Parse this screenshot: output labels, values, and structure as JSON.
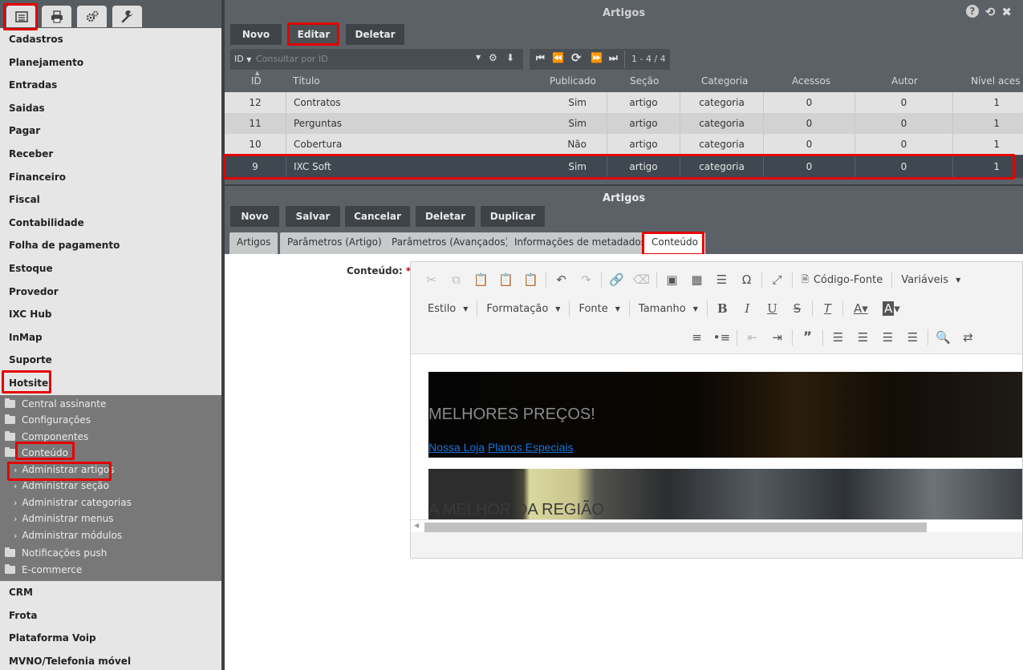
{
  "sidebar": {
    "top_buttons": [
      {
        "name": "menu-icon"
      },
      {
        "name": "print-icon"
      },
      {
        "name": "cogs-icon"
      },
      {
        "name": "wrench-icon"
      }
    ],
    "menu_top": [
      "Cadastros",
      "Planejamento",
      "Entradas",
      "Saidas",
      "Pagar",
      "Receber",
      "Financeiro",
      "Fiscal",
      "Contabilidade",
      "Folha de pagamento",
      "Estoque",
      "Provedor",
      "IXC Hub",
      "InMap",
      "Suporte",
      "Hotsite"
    ],
    "hotsite_children": {
      "folders_before": [
        "Central assinante",
        "Configurações",
        "Componentes"
      ],
      "open_folder": "Conteúdo",
      "leaves": [
        "Administrar artigos",
        "Administrar seção",
        "Administrar categorias",
        "Administrar menus",
        "Administrar módulos"
      ],
      "folders_after": [
        "Notificações push",
        "E-commerce"
      ]
    },
    "menu_bottom": [
      "CRM",
      "Frota",
      "Plataforma Voip",
      "MVNO/Telefonia móvel"
    ]
  },
  "list_panel": {
    "title": "Artigos",
    "buttons": {
      "new": "Novo",
      "edit": "Editar",
      "delete": "Deletar"
    },
    "search": {
      "field": "ID",
      "placeholder": "Consultar por ID"
    },
    "pagination": "1 - 4 / 4",
    "columns": [
      "ID",
      "Título",
      "Publicado",
      "Seção",
      "Categoria",
      "Acessos",
      "Autor",
      "Nível aces"
    ],
    "rows": [
      {
        "id": "12",
        "title": "Contratos",
        "published": "Sim",
        "section": "artigo",
        "category": "categoria",
        "views": "0",
        "author": "0",
        "level": "1"
      },
      {
        "id": "11",
        "title": "Perguntas",
        "published": "Sim",
        "section": "artigo",
        "category": "categoria",
        "views": "0",
        "author": "0",
        "level": "1"
      },
      {
        "id": "10",
        "title": "Cobertura",
        "published": "Não",
        "section": "artigo",
        "category": "categoria",
        "views": "0",
        "author": "0",
        "level": "1"
      },
      {
        "id": "9",
        "title": "IXC Soft",
        "published": "Sim",
        "section": "artigo",
        "category": "categoria",
        "views": "0",
        "author": "0",
        "level": "1"
      }
    ]
  },
  "form_panel": {
    "title": "Artigos",
    "buttons": {
      "new": "Novo",
      "save": "Salvar",
      "cancel": "Cancelar",
      "delete": "Deletar",
      "duplicate": "Duplicar"
    },
    "tabs": [
      "Artigos",
      "Parâmetros (Artigo)",
      "Parâmetros (Avançados)",
      "Informações de metadados",
      "Conteúdo"
    ],
    "field_label": "Conteúdo:",
    "required_mark": "*",
    "editor": {
      "source_label": "Código-Fonte",
      "variables_label": "Variáveis",
      "style_label": "Estilo",
      "format_label": "Formatação",
      "font_label": "Fonte",
      "size_label": "Tamanho",
      "banner1_heading": "MELHORES PREÇOS!",
      "link1": "Nossa Loja",
      "link2": "Planos Especiais",
      "banner2_heading": "A MELHOR DA REGIÃO"
    }
  },
  "colors": {
    "highlight": "#e40000",
    "panel": "#5b6167",
    "button_dark": "#3e4348",
    "link": "#1a73d9"
  }
}
